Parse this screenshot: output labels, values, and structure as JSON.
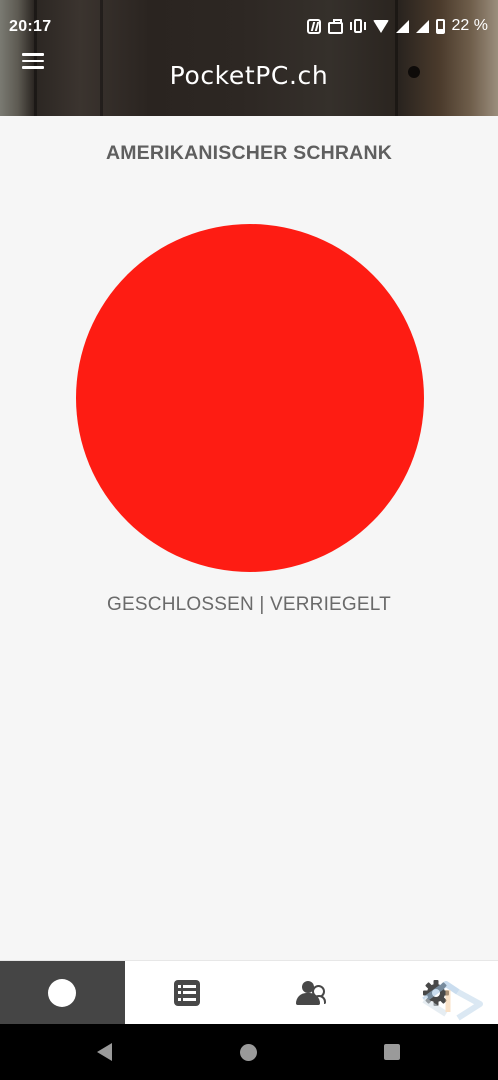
{
  "statusbar": {
    "time": "20:17",
    "battery": "22 %",
    "icons": [
      "nfc-icon",
      "briefcase-icon",
      "vibrate-icon",
      "wifi-icon",
      "signal-icon",
      "signal-icon",
      "battery-icon"
    ]
  },
  "header": {
    "title": "PocketPC.ch",
    "menu_icon": "hamburger-menu-icon"
  },
  "main": {
    "device_name": "AMERIKANISCHER SCHRANK",
    "lock_status": "GESCHLOSSEN | VERRIEGELT",
    "status_color": "#fe1c13"
  },
  "tabbar": {
    "tabs": [
      {
        "icon": "status-dot-icon",
        "active": true
      },
      {
        "icon": "list-icon",
        "active": false
      },
      {
        "icon": "users-icon",
        "active": false
      },
      {
        "icon": "gear-icon",
        "active": false
      }
    ],
    "active_color": "#454545"
  },
  "navbar": {
    "buttons": [
      "back-icon",
      "home-icon",
      "recents-icon"
    ]
  }
}
